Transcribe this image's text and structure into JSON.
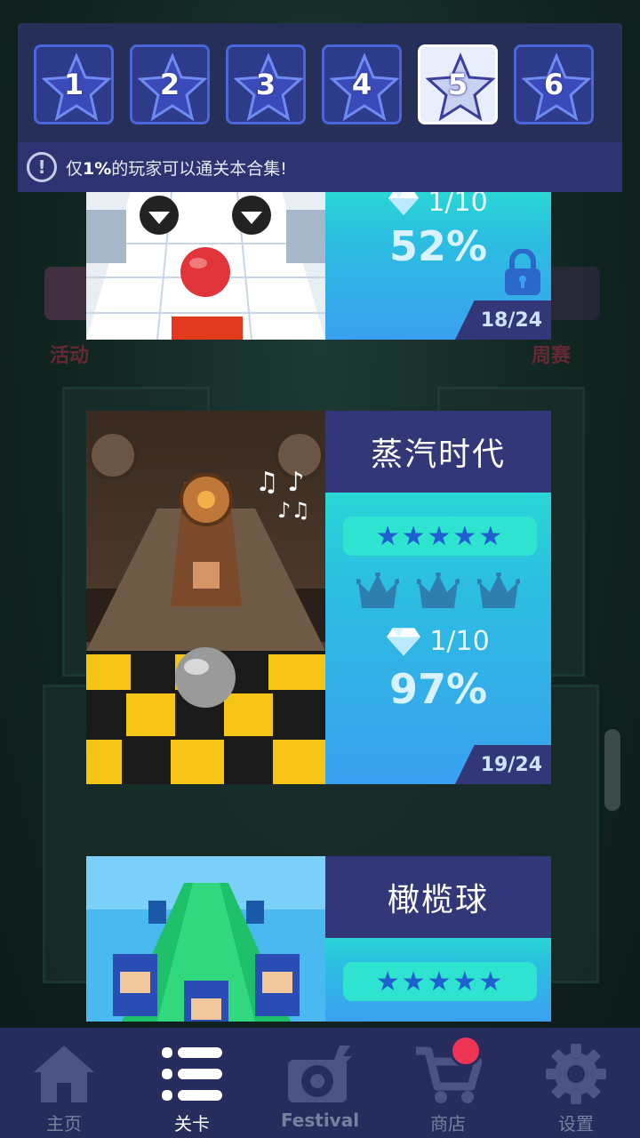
{
  "tiers": [
    {
      "label": "1",
      "active": false
    },
    {
      "label": "2",
      "active": false
    },
    {
      "label": "3",
      "active": false
    },
    {
      "label": "4",
      "active": false
    },
    {
      "label": "5",
      "active": true
    },
    {
      "label": "6",
      "active": false
    }
  ],
  "notice": {
    "prefix": "仅",
    "highlight": "1%",
    "suffix": "的玩家可以通关本合集!"
  },
  "background_labels": {
    "left": "活动",
    "right": "周赛"
  },
  "levels": [
    {
      "name": "",
      "gems": "1/10",
      "percent": "52%",
      "count": "18/24",
      "locked": true
    },
    {
      "name": "蒸汽时代",
      "stars": "★★★★★",
      "gems": "1/10",
      "percent": "97%",
      "count": "19/24",
      "locked": false
    },
    {
      "name": "橄榄球",
      "stars": "★★★★★"
    }
  ],
  "nav": [
    {
      "label": "主页",
      "icon": "home-icon"
    },
    {
      "label": "关卡",
      "icon": "list-icon",
      "active": true
    },
    {
      "label": "Festival",
      "icon": "festival-icon"
    },
    {
      "label": "商店",
      "icon": "cart-icon",
      "badge": true
    },
    {
      "label": "设置",
      "icon": "gear-icon"
    }
  ],
  "colors": {
    "tier_bg": "#2e3a8a",
    "tier_border": "#4a66d8",
    "panel_title": "#323877",
    "info_gradient_top": "#2ad6d6",
    "info_gradient_bottom": "#3aa0f0",
    "nav_bg": "#262d5c",
    "badge": "#ee3355"
  }
}
